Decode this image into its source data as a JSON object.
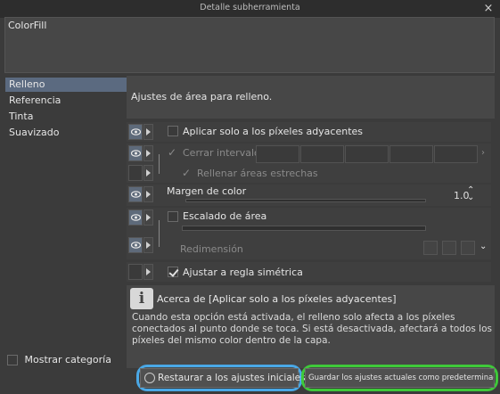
{
  "window": {
    "title": "Detalle subherramienta",
    "close_glyph": "×"
  },
  "tool_name": "ColorFill",
  "categories": [
    {
      "label": "Relleno",
      "selected": true
    },
    {
      "label": "Referencia",
      "selected": false
    },
    {
      "label": "Tinta",
      "selected": false
    },
    {
      "label": "Suavizado",
      "selected": false
    }
  ],
  "show_category": {
    "label": "Mostrar categoría",
    "checked": false
  },
  "section_description": "Ajustes de área para relleno.",
  "settings": {
    "adjacent": {
      "label": "Aplicar solo a los píxeles adyacentes",
      "checked": false
    },
    "close_gap": {
      "label": "Cerrar intervalo",
      "checked": true
    },
    "fill_narrow": {
      "label": "Rellenar áreas estrechas",
      "checked": true
    },
    "color_margin": {
      "label": "Margen de color",
      "value": "1.0"
    },
    "area_scaling": {
      "label": "Escalado de área",
      "checked": false
    },
    "resize": {
      "label": "Redimensión"
    },
    "symmetry": {
      "label": "Ajustar a regla simétrica",
      "checked": true
    }
  },
  "info": {
    "icon": "info-icon",
    "title": "Acerca de [Aplicar solo a los píxeles adyacentes]",
    "body": "Cuando esta opción está activada, el relleno solo afecta a los píxeles conectados al punto donde se toca. Si está desactivada, afectará a todos los píxeles del mismo color dentro de la capa."
  },
  "buttons": {
    "restore": "Restaurar a los ajustes iniciales",
    "save_default": "Guardar los ajustes actuales como predeterminados"
  },
  "colors": {
    "selected_category": "#5b6a80",
    "highlight_restore": "#4aa8e6",
    "highlight_save": "#3fc93a"
  }
}
